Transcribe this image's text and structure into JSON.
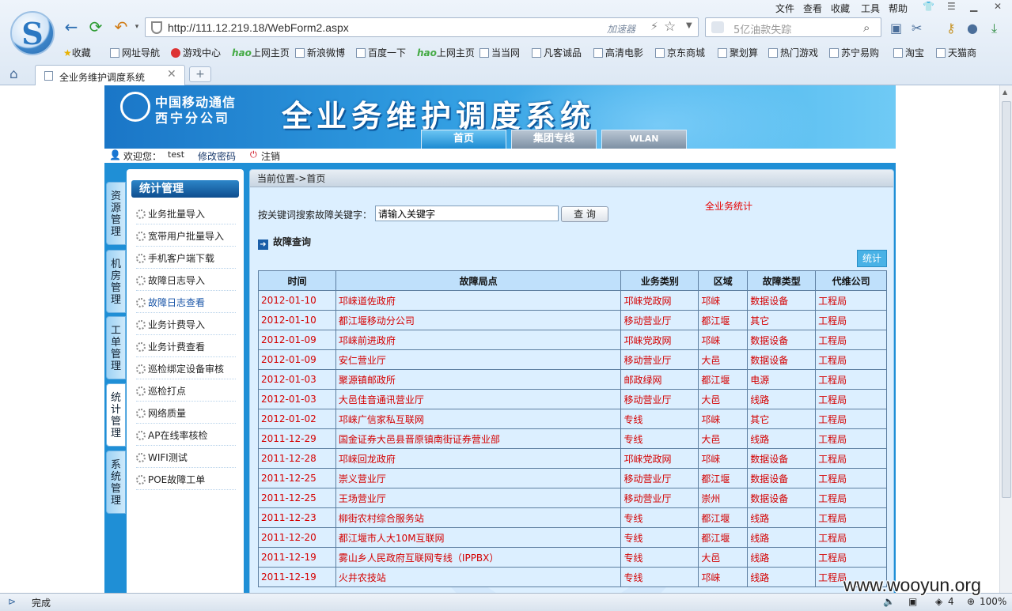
{
  "browser": {
    "menu": [
      "文件",
      "查看",
      "收藏",
      "工具",
      "帮助"
    ],
    "url": "http://111.12.219.18/WebForm2.aspx",
    "accelerator": "加速器",
    "search_placeholder": "5亿油款失踪",
    "favorites": [
      "收藏",
      "网址导航",
      "游戏中心",
      "上网主页",
      "新浪微博",
      "百度一下",
      "上网主页",
      "当当网",
      "凡客诚品",
      "高清电影",
      "京东商城",
      "聚划算",
      "热门游戏",
      "苏宁易购",
      "淘宝",
      "天猫商"
    ],
    "tab_title": "全业务维护调度系统",
    "status": "完成",
    "status_count": "4",
    "zoom": "100%"
  },
  "site": {
    "company_line1": "中国移动通信",
    "company_line2": "西宁分公司",
    "system_title": "全业务维护调度系统",
    "nav_tabs": [
      "首页",
      "集团专线",
      "WLAN"
    ],
    "welcome_label": "欢迎您：",
    "username": "test",
    "change_password": "修改密码",
    "logout": "注销"
  },
  "vertical_tabs": [
    "资源管理",
    "机房管理",
    "工单管理",
    "统计管理",
    "系统管理"
  ],
  "sidebar": {
    "title": "统计管理",
    "items": [
      "业务批量导入",
      "宽带用户批量导入",
      "手机客户端下载",
      "故障日志导入",
      "故障日志查看",
      "业务计费导入",
      "业务计费查看",
      "巡检绑定设备审核",
      "巡检打点",
      "网络质量",
      "AP在线率核检",
      "WIFI测试",
      "POE故障工单"
    ]
  },
  "main": {
    "breadcrumb": "当前位置->首页",
    "search_label": "按关键词搜索故障关键字：",
    "search_value": "请输入关键字",
    "search_button": "查 询",
    "all_stats_link": "全业务统计",
    "section_title": "故障查询",
    "stats_button": "统计",
    "columns": [
      "时间",
      "故障局点",
      "业务类别",
      "区域",
      "故障类型",
      "代维公司"
    ],
    "rows": [
      [
        "2012-01-10",
        "邛崃道佐政府",
        "邛崃党政网",
        "邛崃",
        "数据设备",
        "工程局"
      ],
      [
        "2012-01-10",
        "都江堰移动分公司",
        "移动营业厅",
        "都江堰",
        "其它",
        "工程局"
      ],
      [
        "2012-01-09",
        "邛崃前进政府",
        "邛崃党政网",
        "邛崃",
        "数据设备",
        "工程局"
      ],
      [
        "2012-01-09",
        "安仁营业厅",
        "移动营业厅",
        "大邑",
        "数据设备",
        "工程局"
      ],
      [
        "2012-01-03",
        "聚源镇邮政所",
        "邮政绿网",
        "都江堰",
        "电源",
        "工程局"
      ],
      [
        "2012-01-03",
        "大邑佳音通讯营业厅",
        "移动营业厅",
        "大邑",
        "线路",
        "工程局"
      ],
      [
        "2012-01-02",
        "邛崃广信家私互联网",
        "专线",
        "邛崃",
        "其它",
        "工程局"
      ],
      [
        "2011-12-29",
        "国金证券大邑县晋原镇南街证券营业部",
        "专线",
        "大邑",
        "线路",
        "工程局"
      ],
      [
        "2011-12-28",
        "邛崃回龙政府",
        "邛崃党政网",
        "邛崃",
        "数据设备",
        "工程局"
      ],
      [
        "2011-12-25",
        "崇义营业厅",
        "移动营业厅",
        "都江堰",
        "数据设备",
        "工程局"
      ],
      [
        "2011-12-25",
        "王场营业厅",
        "移动营业厅",
        "崇州",
        "数据设备",
        "工程局"
      ],
      [
        "2011-12-23",
        "柳街农村综合服务站",
        "专线",
        "都江堰",
        "线路",
        "工程局"
      ],
      [
        "2011-12-20",
        "都江堰市人大10M互联网",
        "专线",
        "都江堰",
        "线路",
        "工程局"
      ],
      [
        "2011-12-19",
        "雾山乡人民政府互联网专线（IPPBX）",
        "专线",
        "大邑",
        "线路",
        "工程局"
      ],
      [
        "2011-12-19",
        "火井农技站",
        "专线",
        "邛崃",
        "线路",
        "工程局"
      ]
    ]
  },
  "watermark": "www.wooyun.org"
}
